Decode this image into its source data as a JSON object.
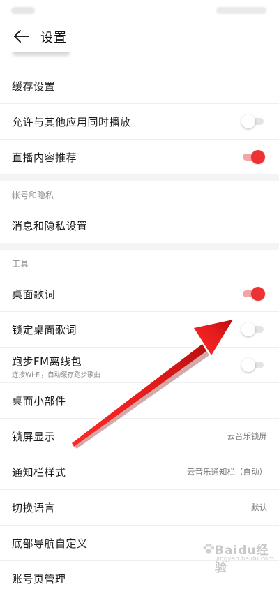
{
  "header": {
    "title": "设置"
  },
  "rows_top": [
    {
      "label": "缓存设置"
    },
    {
      "label": "允许与其他应用同时播放",
      "toggle": false
    },
    {
      "label": "直播内容推荐",
      "toggle": true
    }
  ],
  "section_account": {
    "title": "帐号和隐私",
    "rows": [
      {
        "label": "消息和隐私设置"
      }
    ]
  },
  "section_tools": {
    "title": "工具",
    "rows": [
      {
        "label": "桌面歌词",
        "toggle": true
      },
      {
        "label": "锁定桌面歌词",
        "toggle": false
      },
      {
        "label": "跑步FM离线包",
        "sublabel": "连接Wi-Fi，自动缓存跑步歌曲",
        "toggle": false
      },
      {
        "label": "桌面小部件"
      },
      {
        "label": "锁屏显示",
        "value": "云音乐锁屏"
      },
      {
        "label": "通知栏样式",
        "value": "云音乐通知栏（自动）"
      },
      {
        "label": "切换语言",
        "value": "默认"
      },
      {
        "label": "底部导航自定义"
      },
      {
        "label": "账号页管理"
      }
    ]
  },
  "watermark": {
    "text": "Baidu经验",
    "sub": "jingyan.baidu.com"
  },
  "colors": {
    "accent": "#ec3232",
    "accent_track": "#f3a5a5",
    "arrow": "#e51b1b",
    "section_gap": "#f4f4f4"
  },
  "icons": {
    "back": "arrow-left-icon",
    "watermark": "paw-icon"
  }
}
